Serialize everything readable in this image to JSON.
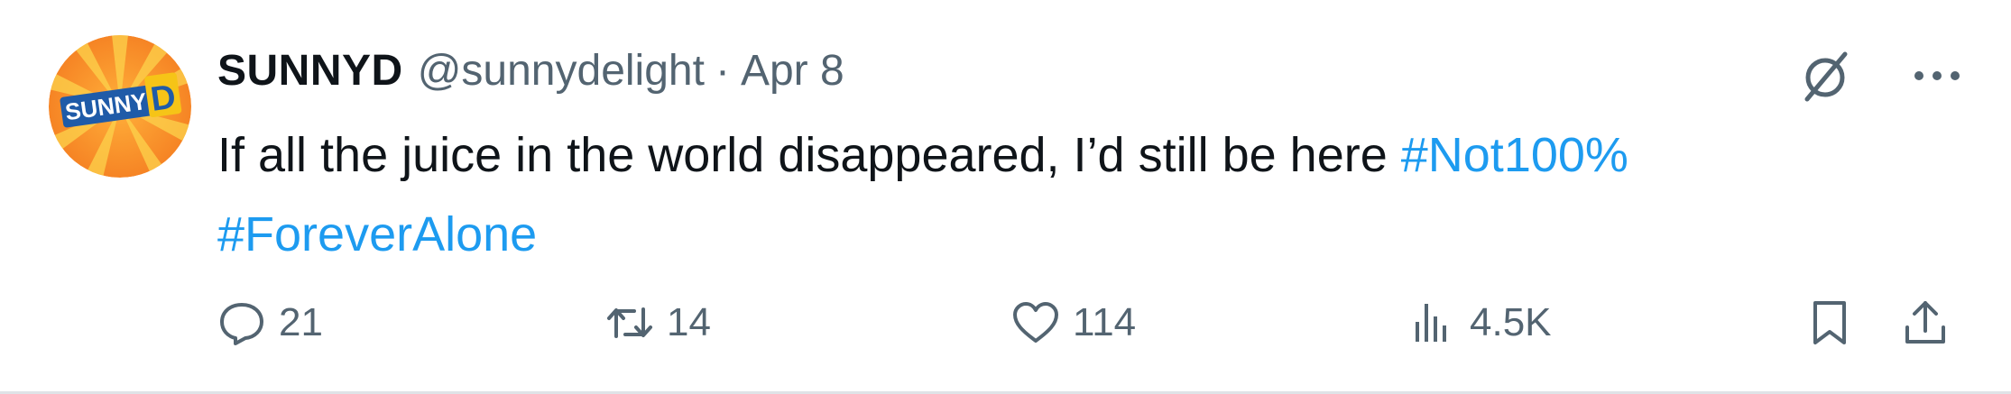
{
  "tweet": {
    "author_name": "SUNNYD",
    "handle": "@sunnydelight",
    "separator": "·",
    "date": "Apr 8",
    "text": "If all the juice in the world disappeared, I’d still be here ",
    "hashtags": [
      "#Not100%",
      "#ForeverAlone"
    ],
    "avatar_logo_text": "SUNNY D",
    "avatar_icon": "sunnyd-logo",
    "top_icons": [
      "grok-icon",
      "more-icon"
    ]
  },
  "actions": {
    "reply": {
      "icon": "reply-icon",
      "count": "21"
    },
    "retweet": {
      "icon": "retweet-icon",
      "count": "14"
    },
    "like": {
      "icon": "heart-icon",
      "count": "114"
    },
    "views": {
      "icon": "analytics-icon",
      "count": "4.5K"
    },
    "bookmark": {
      "icon": "bookmark-icon"
    },
    "share": {
      "icon": "share-icon"
    }
  },
  "colors": {
    "text": "#0f1419",
    "secondary": "#536471",
    "link": "#1d9bf0",
    "avatar_orange": "#f7941d"
  }
}
